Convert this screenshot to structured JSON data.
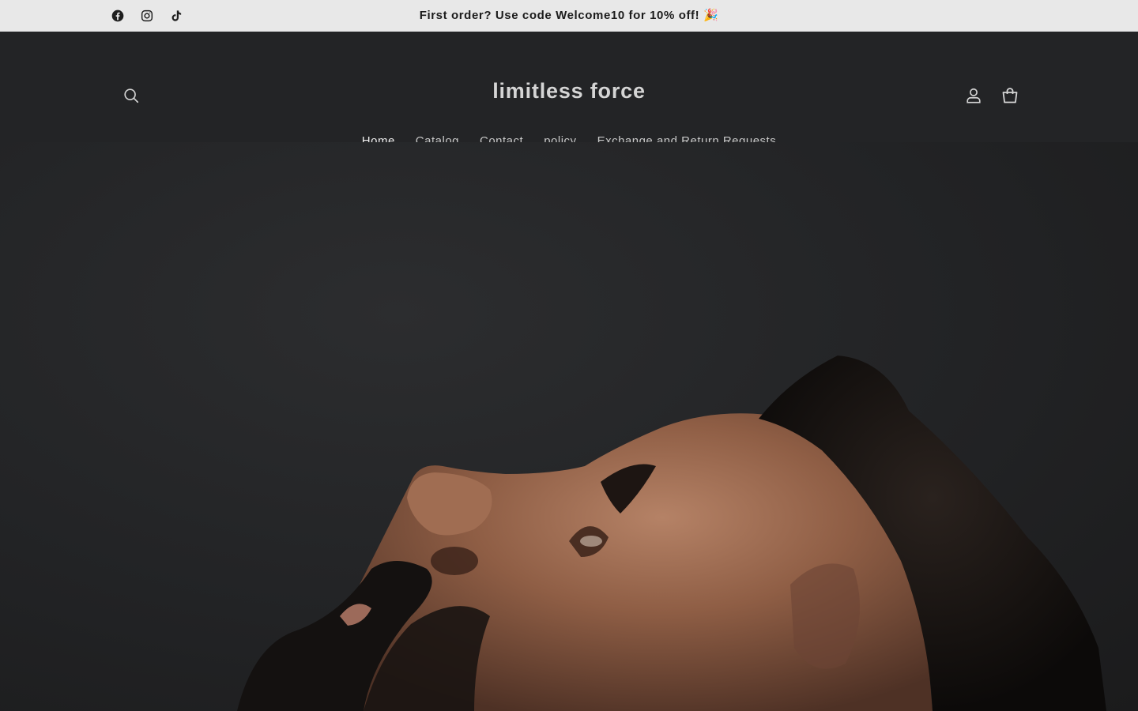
{
  "announcement": {
    "text": "First order? Use code Welcome10 for 10% off! 🎉",
    "social_icons": [
      "facebook-icon",
      "instagram-icon",
      "tiktok-icon"
    ]
  },
  "header": {
    "logo": "limitless force",
    "icons": {
      "search": "search-icon",
      "account": "account-icon",
      "cart": "cart-icon"
    }
  },
  "nav": {
    "items": [
      {
        "label": "Home",
        "active": true
      },
      {
        "label": "Catalog",
        "active": false
      },
      {
        "label": "Contact",
        "active": false
      },
      {
        "label": "policy",
        "active": false
      },
      {
        "label": "Exchange and Return Requests",
        "active": false
      }
    ]
  },
  "colors": {
    "announcement_bg": "#e8e8e8",
    "header_bg": "#232426",
    "header_text": "#d5d5d5"
  }
}
